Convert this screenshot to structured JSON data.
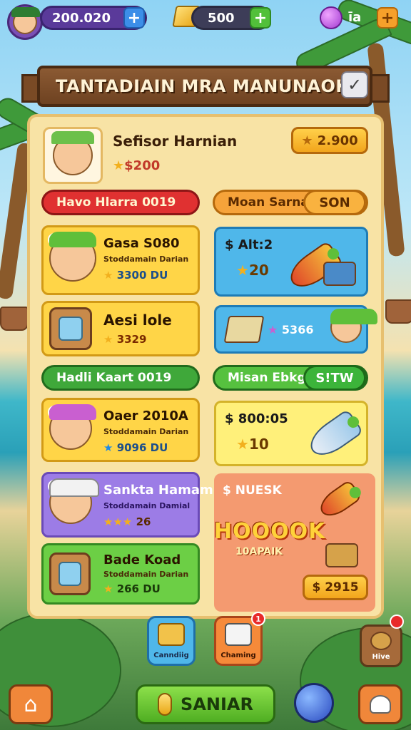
{
  "top_bar": {
    "currency_1": "200.020",
    "currency_2": "500",
    "currency_3": "ı̄a",
    "plus_symbol": "+"
  },
  "banner": {
    "title": "TANTADIAIN MRA MANUNAOK!",
    "close_symbol": "✓"
  },
  "profile": {
    "name": "Sefisor Harnian",
    "coins": "$200",
    "balance": "2.900"
  },
  "tabs": {
    "red": "Havo Hlarra 0019",
    "orange": "Moan Sarnah",
    "orange_pill": "SON",
    "green_left": "Hadli Kaart 0019",
    "green_right": "Misan Ebkgen",
    "green_right_pill": "S!TW"
  },
  "left_cards": [
    {
      "title": "Gasa S080",
      "sub": "Stoddamain Darian",
      "value": "3300",
      "unit": "DU"
    },
    {
      "title": "Aesi lole",
      "value": "3329"
    },
    {
      "title": "Oaer 2010A",
      "sub": "Stoddamain Darian",
      "value": "9096",
      "unit": "DU"
    },
    {
      "title": "Sankta Hamam",
      "sub": "Stoddamain Damial",
      "value": "26"
    },
    {
      "title": "Bade Koad",
      "sub": "Stoddamain Darian",
      "value": "266",
      "unit": "DU"
    }
  ],
  "right_cards": [
    {
      "title": "$ Alt:2",
      "value": "20"
    },
    {
      "value": "5366"
    },
    {
      "title": "$ 800:05",
      "value": "10"
    }
  ],
  "promo": {
    "title": "$ NUESK",
    "headline": "HOOOOK",
    "subline": "10APAIK",
    "price": "$ 2915"
  },
  "bottom": {
    "btn_left_label": "Canndiig",
    "btn_right_label": "Chaming",
    "notif_count": "1",
    "hive_label": "Hive",
    "main_button": "SANIAR"
  },
  "colors": {
    "panel": "#f8e3a5",
    "banner": "#7a4a25",
    "accent_gold": "#f2a51c",
    "accent_green": "#4fae22"
  }
}
